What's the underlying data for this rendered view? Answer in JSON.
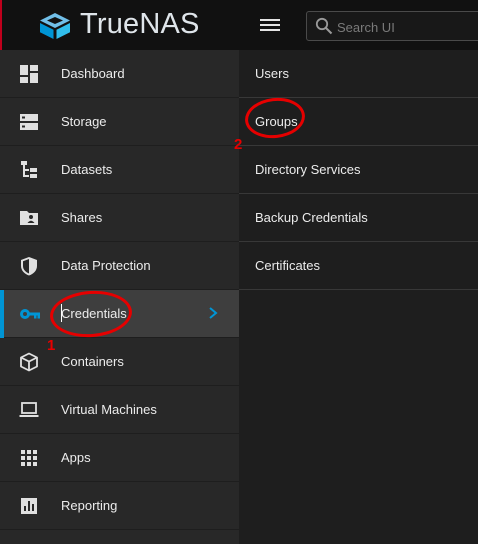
{
  "brand": {
    "name": "TrueNAS"
  },
  "search": {
    "placeholder": "Search UI"
  },
  "sidebar": {
    "items": [
      {
        "label": "Dashboard",
        "icon": "dashboard-icon"
      },
      {
        "label": "Storage",
        "icon": "storage-icon"
      },
      {
        "label": "Datasets",
        "icon": "datasets-icon"
      },
      {
        "label": "Shares",
        "icon": "shares-icon"
      },
      {
        "label": "Data Protection",
        "icon": "shield-icon"
      },
      {
        "label": "Credentials",
        "icon": "key-icon",
        "active": true
      },
      {
        "label": "Containers",
        "icon": "cube-icon"
      },
      {
        "label": "Virtual Machines",
        "icon": "laptop-icon"
      },
      {
        "label": "Apps",
        "icon": "apps-grid-icon"
      },
      {
        "label": "Reporting",
        "icon": "reporting-icon"
      }
    ]
  },
  "submenu": {
    "items": [
      {
        "label": "Users"
      },
      {
        "label": "Groups"
      },
      {
        "label": "Directory Services"
      },
      {
        "label": "Backup Credentials"
      },
      {
        "label": "Certificates"
      }
    ]
  },
  "annotations": {
    "step1": "1",
    "step2": "2",
    "color": "#e60000"
  },
  "colors": {
    "accent": "#0095d5",
    "sidebar_bg": "#282828",
    "active_bg": "#3e3e3e",
    "topbar_bg": "#111111"
  }
}
